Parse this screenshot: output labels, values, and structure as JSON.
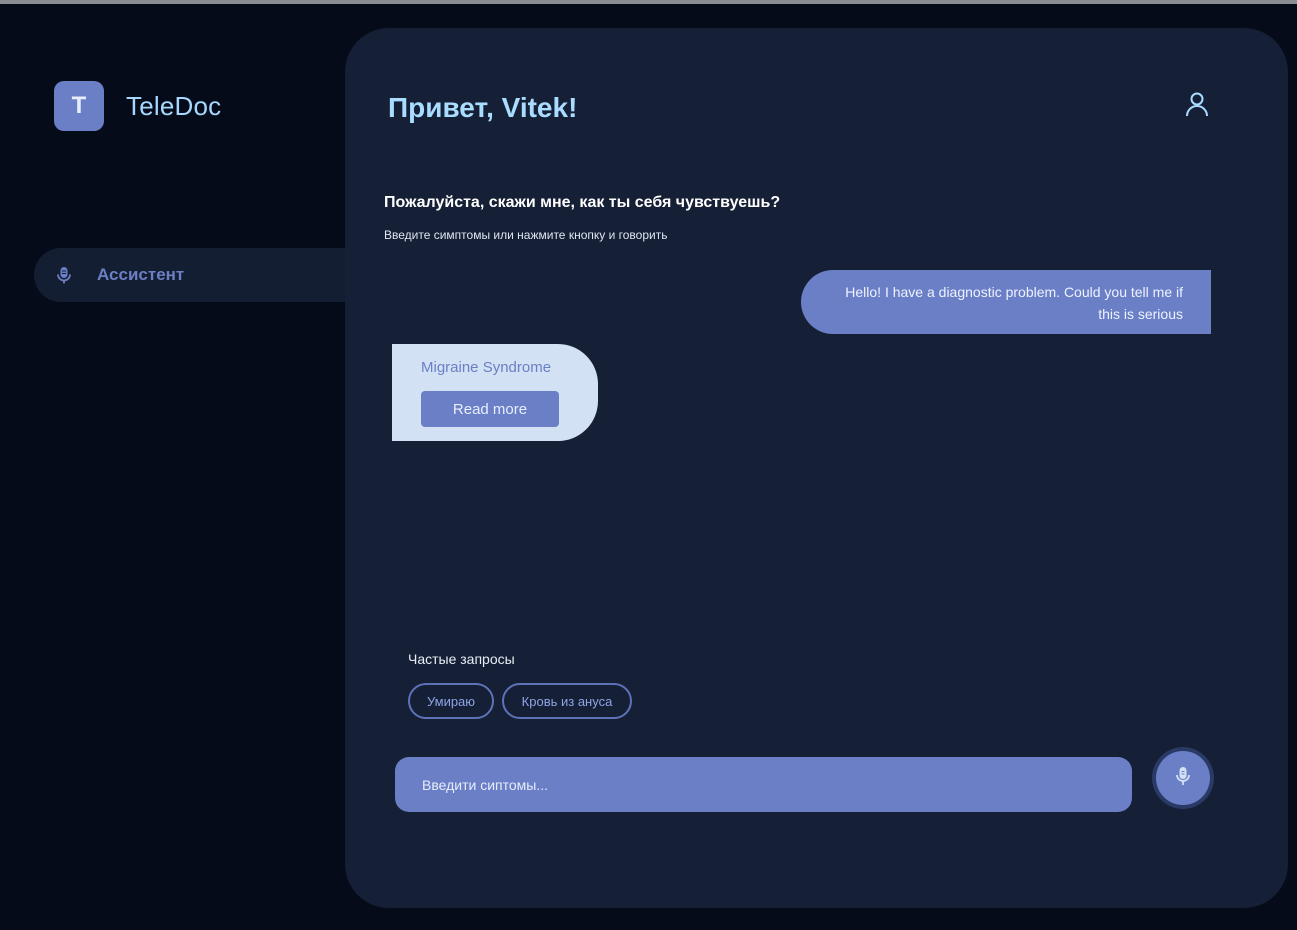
{
  "brand": {
    "logo_letter": "T",
    "name": "TeleDoc"
  },
  "sidebar": {
    "items": [
      {
        "label": "Ассистент",
        "icon": "microphone-icon",
        "active": true
      }
    ]
  },
  "header": {
    "greeting": "Привет, Vitek!",
    "profile_icon": "user-icon"
  },
  "prompt": {
    "question": "Пожалуйста, скажи мне, как ты себя чувствуешь?",
    "hint": "Введите симптомы или нажмите кнопку и говорить"
  },
  "chat": {
    "user_message": "Hello! I have a diagnostic problem. Could you tell me if this is serious",
    "bot_diagnosis": "Migraine Syndrome",
    "bot_button": "Read more"
  },
  "faq": {
    "title": "Частые запросы",
    "chips": [
      "Умираю",
      "Кровь из ануса"
    ]
  },
  "input": {
    "placeholder": "Введити сиптомы...",
    "value": ""
  },
  "colors": {
    "accent": "#6a7fc6",
    "panel": "#151f35",
    "background": "#060b19",
    "title": "#a9dcff",
    "card": "#d2e1f3"
  }
}
